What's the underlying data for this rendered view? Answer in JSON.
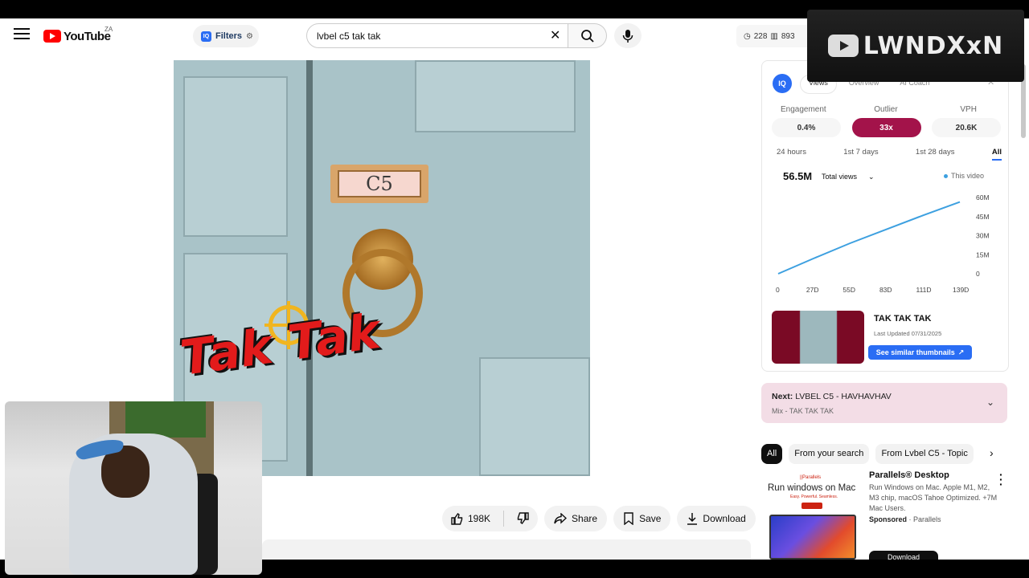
{
  "header": {
    "logo_word": "YouTube",
    "country": "ZA",
    "filters_label": "Filters",
    "filters_badge": "IQ",
    "search_value": "lvbel c5 tak tak",
    "clear_glyph": "✕",
    "stats": {
      "left": "228",
      "right": "893"
    }
  },
  "overlay": {
    "channel": "LWNDXxN"
  },
  "video": {
    "plate_text": "C5",
    "sticker_text": "Tak Tak"
  },
  "actions": {
    "likes": "198K",
    "share": "Share",
    "save": "Save",
    "download": "Download",
    "more": "•••"
  },
  "iq": {
    "logo": "IQ",
    "tabs": [
      "Views",
      "Overview",
      "AI Coach"
    ],
    "close": "✕",
    "metric_labels": [
      "Engagement",
      "Outlier",
      "VPH"
    ],
    "metric_values": [
      "0.4%",
      "33x",
      "20.6K"
    ],
    "ranges": [
      "24 hours",
      "1st 7 days",
      "1st 28 days",
      "All"
    ],
    "views_total": "56.5M",
    "views_select": "Total views",
    "legend": "This video",
    "thumb_title": "TAK TAK TAK",
    "thumb_updated": "Last Updated 07/31/2025",
    "similar_btn": "See similar thumbnails"
  },
  "chart_data": {
    "type": "line",
    "x": [
      0,
      27,
      55,
      83,
      111,
      139
    ],
    "x_labels": [
      "0",
      "27D",
      "55D",
      "83D",
      "111D",
      "139D"
    ],
    "y_labels": [
      "60M",
      "45M",
      "30M",
      "15M",
      "0"
    ],
    "ylim": [
      0,
      60
    ],
    "series": [
      {
        "name": "This video",
        "color": "#3da0e0",
        "values": [
          0,
          12,
          24,
          35,
          46,
          56.5
        ]
      }
    ]
  },
  "next": {
    "label": "Next:",
    "title": "LVBEL C5 - HAVHAVHAV",
    "sub": "Mix - TAK TAK TAK"
  },
  "chips": [
    "All",
    "From your search",
    "From Lvbel C5 - Topic"
  ],
  "ad": {
    "brand_tag": "||Parallels",
    "headline": "Run windows on Mac",
    "tiny": "Easy. Powerful. Seamless.",
    "title": "Parallels® Desktop",
    "desc": "Run Windows on Mac. Apple M1, M2, M3 chip, macOS Tahoe Optimized. +7M Mac Users.",
    "sponsored": "Sponsored",
    "advertiser": "Parallels",
    "cta": "Download"
  }
}
